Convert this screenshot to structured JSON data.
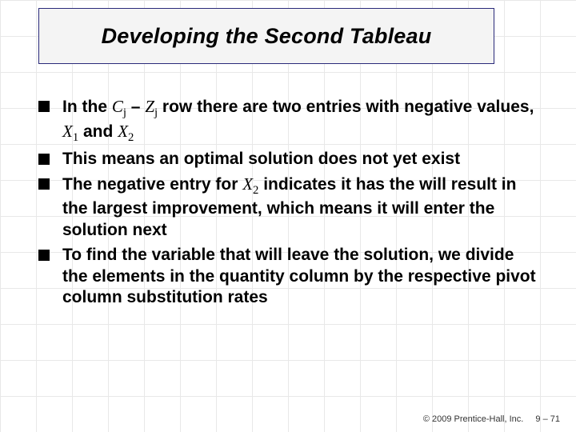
{
  "title": "Developing the Second Tableau",
  "bullets": {
    "b1": {
      "pre": "In the ",
      "Cj": "C",
      "jsub1": "j",
      "dash": " – ",
      "Zj": "Z",
      "jsub2": "j",
      "mid": " row there are two entries with negative values, ",
      "X1": "X",
      "sub1": "1",
      "and": " and ",
      "X2": "X",
      "sub2": "2"
    },
    "b2": "This means an optimal solution does not yet exist",
    "b3": {
      "pre": "The negative entry for ",
      "X2": "X",
      "sub2": "2",
      "post": " indicates it has the will result in the largest improvement, which means it will enter the solution next"
    },
    "b4": "To find the variable that will leave the solution, we divide the elements in the quantity column by the respective pivot column substitution rates"
  },
  "footer": {
    "copyright": "© 2009 Prentice-Hall, Inc.",
    "page": "9 – 71"
  }
}
